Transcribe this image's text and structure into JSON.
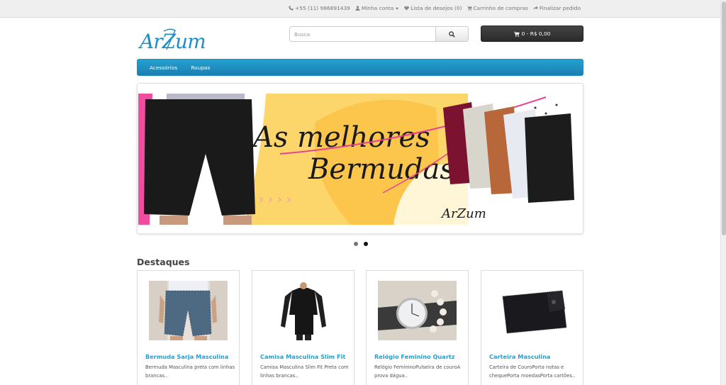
{
  "topbar": {
    "phone": "+55 (11) 986891439",
    "account": "Minha conta",
    "wishlist": "Lista de desejos (0)",
    "cart": "Carrinho de compras",
    "checkout": "Finalizar pedido"
  },
  "header": {
    "logo_text": "ArZum",
    "search_placeholder": "Busca",
    "cart_button": "0 - R$ 0,00"
  },
  "menu": {
    "items": [
      "Acessórios",
      "Roupas"
    ]
  },
  "banner": {
    "headline_line1": "As melhores",
    "headline_line2": "Bermudas",
    "brand": "ArZum",
    "active_slide": 2,
    "slide_count": 2
  },
  "featured": {
    "title": "Destaques",
    "products": [
      {
        "name": "Bermuda Sarja Masculina",
        "desc": "Bermuda Masculina preta com linhas brancas.."
      },
      {
        "name": "Camisa Masculina Slim Fit",
        "desc": "Camisa Masculina Slim Fit Preta com linhas brancas.."
      },
      {
        "name": "Relógio Feminino Quartz",
        "desc": "Relógio FemininoPulseira de couroA prova dágua.."
      },
      {
        "name": "Carteira Masculina",
        "desc": "Carteira de CouroPorta notas e chequePorta moedasPorta cartões.."
      }
    ]
  },
  "colors": {
    "accent": "#23a1d1",
    "banner_yellow": "#fbc64b",
    "banner_pink": "#f04da0"
  }
}
